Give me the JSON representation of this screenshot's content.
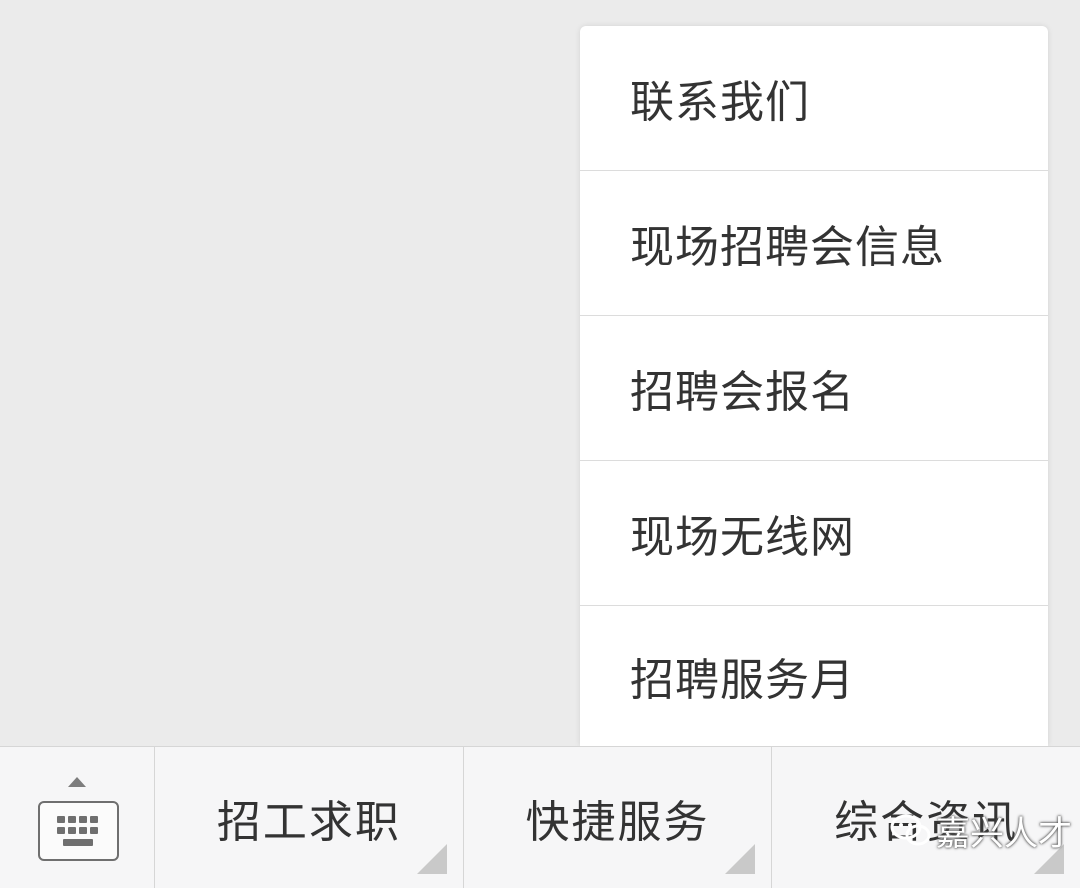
{
  "popup_menu": {
    "items": [
      {
        "label": "联系我们"
      },
      {
        "label": "现场招聘会信息"
      },
      {
        "label": "招聘会报名"
      },
      {
        "label": "现场无线网"
      },
      {
        "label": "招聘服务月"
      }
    ]
  },
  "menu_bar": {
    "keyboard_icon": "keyboard-icon",
    "buttons": [
      {
        "label": "招工求职"
      },
      {
        "label": "快捷服务"
      },
      {
        "label": "综合资讯"
      }
    ]
  },
  "watermark": {
    "text": "嘉兴人才",
    "icon": "wechat-icon"
  },
  "colors": {
    "background": "#ebebeb",
    "menu_bar": "#f6f6f7",
    "popup": "#ffffff",
    "text": "#333333"
  }
}
